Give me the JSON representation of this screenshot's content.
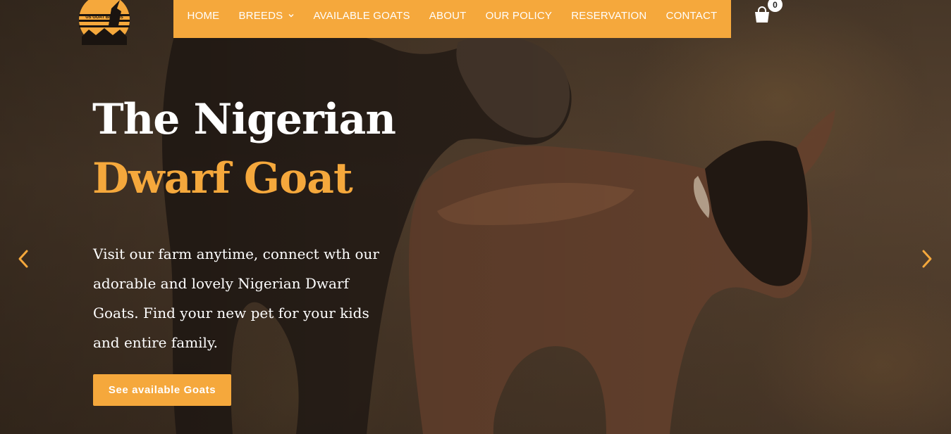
{
  "colors": {
    "accent": "#f5a83c",
    "text_light": "#ffffff"
  },
  "logo": {
    "icon": "goat-logo-icon",
    "text": "US GOAT BREEDS"
  },
  "nav": {
    "items": [
      {
        "label": "HOME"
      },
      {
        "label": "BREEDS",
        "has_dropdown": true
      },
      {
        "label": "AVAILABLE GOATS"
      },
      {
        "label": "ABOUT"
      },
      {
        "label": "OUR POLICY"
      },
      {
        "label": "RESERVATION"
      },
      {
        "label": "CONTACT"
      }
    ]
  },
  "cart": {
    "icon": "shopping-bag-icon",
    "count": "0"
  },
  "hero": {
    "title_line1": "The Nigerian",
    "title_line2": "Dwarf Goat",
    "description": "Visit our farm anytime, connect wth our adorable and lovely Nigerian Dwarf Goats. Find your new pet for your kids and entire family.",
    "cta_label": "See available Goats"
  },
  "slider": {
    "prev_icon": "chevron-left-icon",
    "next_icon": "chevron-right-icon"
  }
}
